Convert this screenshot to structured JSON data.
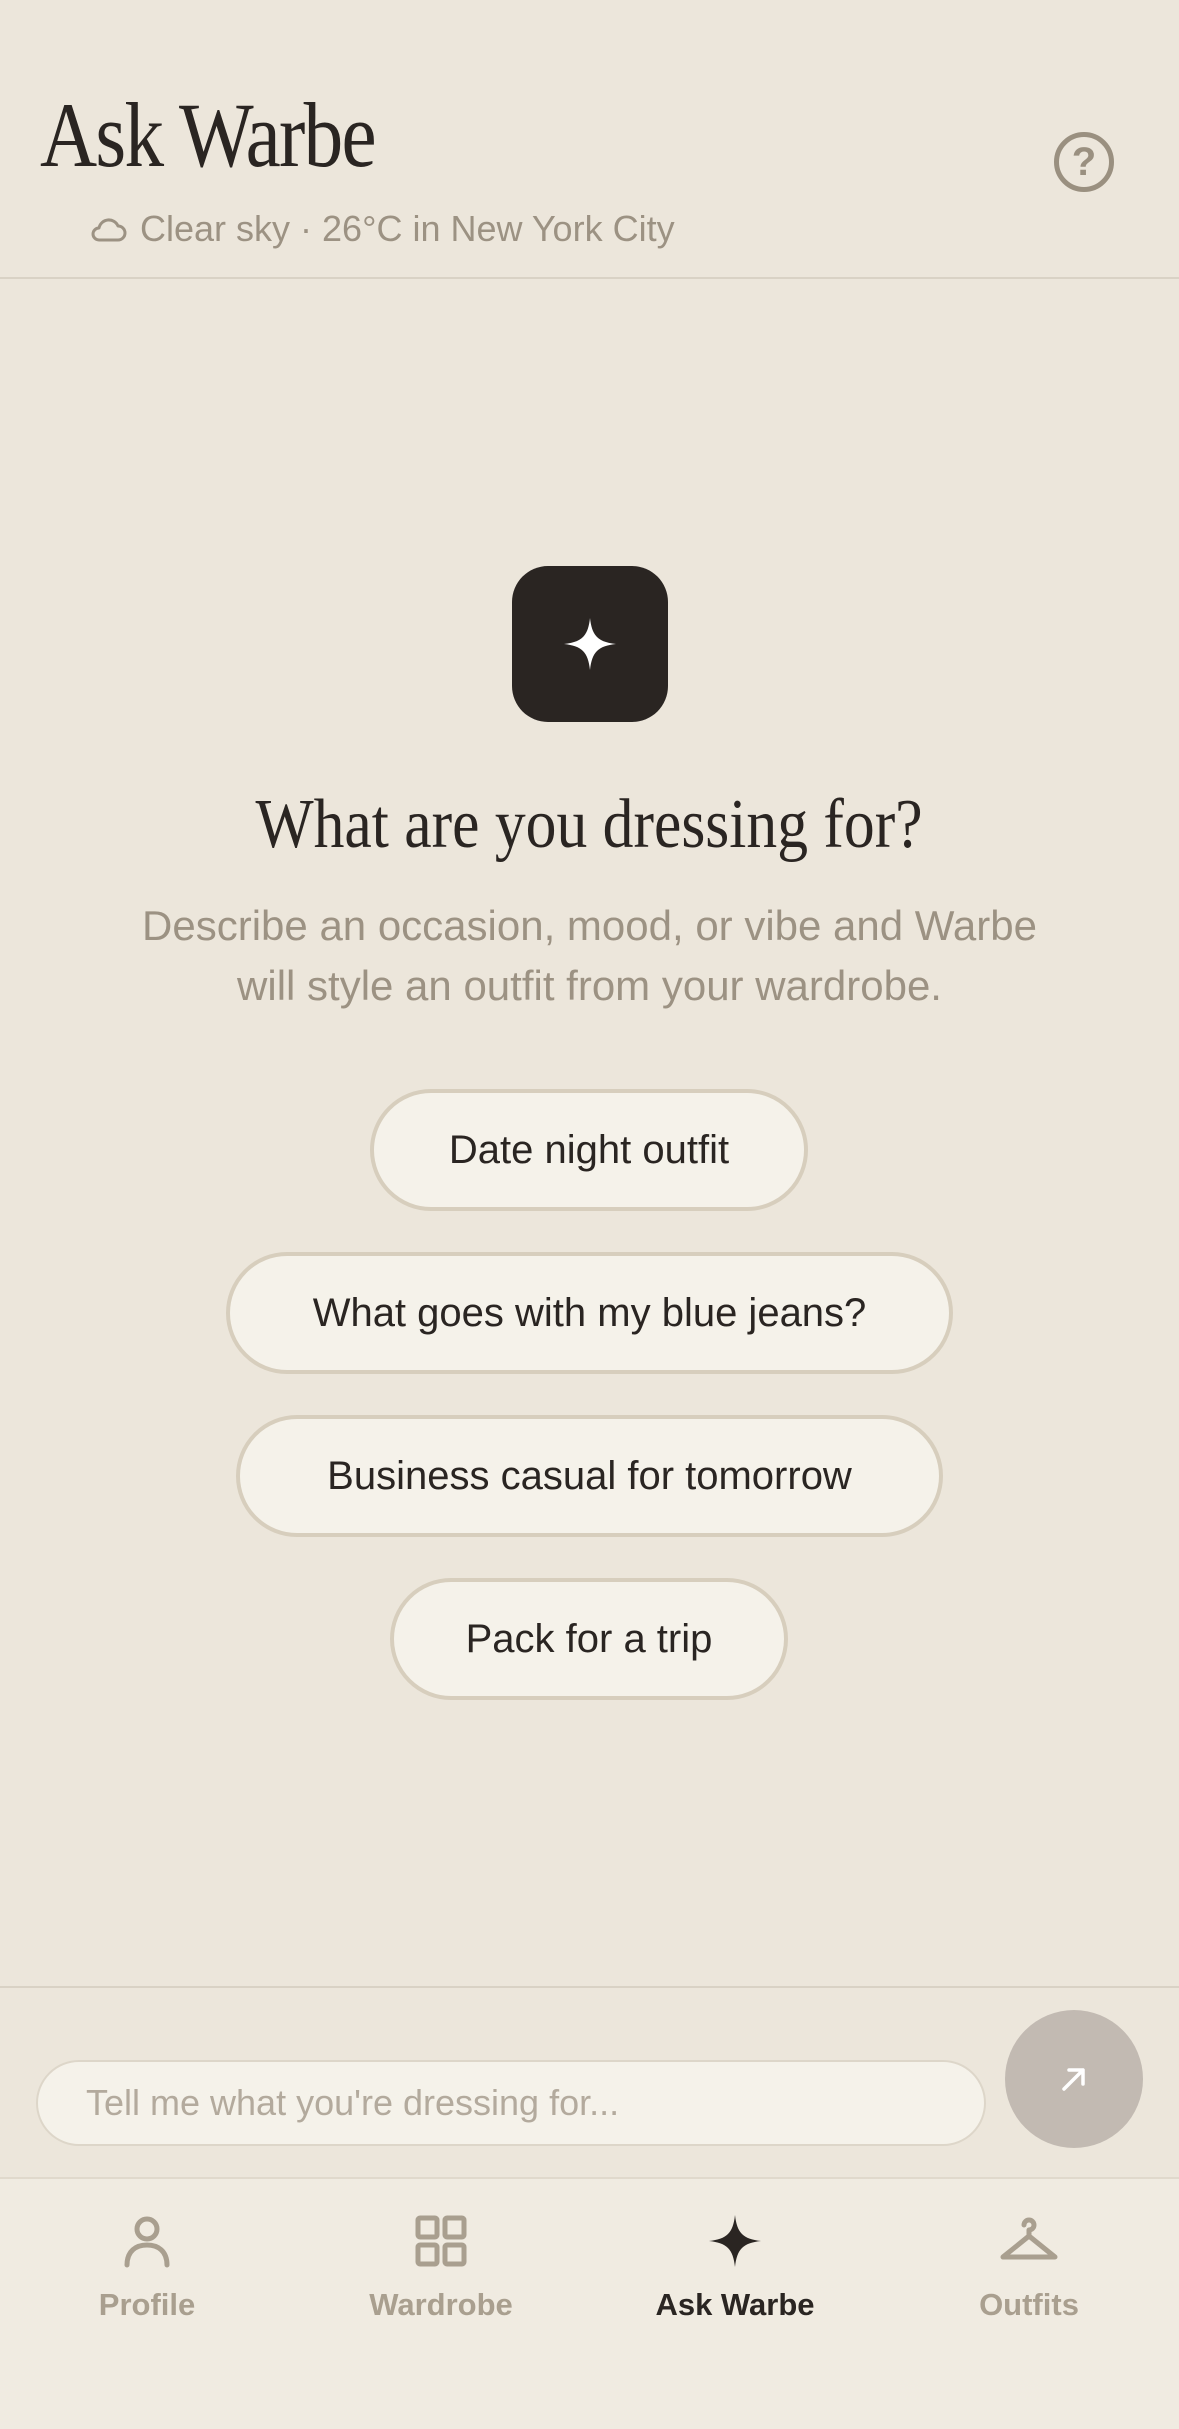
{
  "header": {
    "title": "Ask Warbe",
    "help_icon": "question-circle-icon",
    "weather_icon": "cloud-icon",
    "weather_text": "Clear sky · 26°C in New York City"
  },
  "main": {
    "hero_icon": "sparkle-icon",
    "title": "What are you dressing for?",
    "subtitle_line1": "Describe an occasion, mood, or vibe and Warbe",
    "subtitle_line2": "will style an outfit from your wardrobe.",
    "suggestions": [
      "Date night outfit",
      "What goes with my blue jeans?",
      "Business casual for tomorrow",
      "Pack for a trip"
    ]
  },
  "composer": {
    "placeholder": "Tell me what you're dressing for...",
    "value": "",
    "send_icon": "arrow-up-right-icon"
  },
  "tabbar": {
    "active": "Ask Warbe",
    "items": [
      {
        "label": "Profile",
        "icon": "person-icon"
      },
      {
        "label": "Wardrobe",
        "icon": "grid-icon"
      },
      {
        "label": "Ask Warbe",
        "icon": "sparkle-icon"
      },
      {
        "label": "Outfits",
        "icon": "hanger-icon"
      }
    ]
  },
  "colors": {
    "background": "#ece6db",
    "ink": "#2a2522",
    "muted": "#9c9283",
    "chip_bg": "#f5f2ea",
    "chip_border": "#d7cebd",
    "send_button": "#c2bab2"
  }
}
